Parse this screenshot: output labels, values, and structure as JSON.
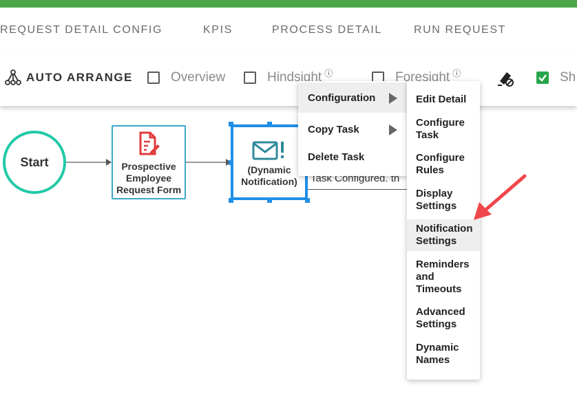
{
  "tabs": [
    "REQUEST DETAIL CONFIG",
    "KPIS",
    "PROCESS DETAIL",
    "RUN REQUEST"
  ],
  "toolbar": {
    "auto_arrange_label": "AUTO ARRANGE",
    "overview_label": "Overview",
    "hindsight_label": "Hindsight",
    "foresight_label": "Foresight",
    "show_label": "Sh",
    "overview_checked": false,
    "hindsight_checked": false,
    "foresight_checked": false,
    "show_checked": true
  },
  "canvas": {
    "start_label": "Start",
    "task1_label_lines": [
      "Prospective",
      "Employee",
      "Request Form"
    ],
    "task2_label_lines": [
      "(Dynamic",
      "Notification)"
    ],
    "tooltip_text": "Task Configured. th"
  },
  "context_menu": {
    "items": [
      "Configuration",
      "Copy Task",
      "Delete Task"
    ]
  },
  "submenu": {
    "items": [
      "Edit Detail",
      "Configure Task",
      "Configure Rules",
      "Display Settings",
      "Notification Settings",
      "Reminders and Timeouts",
      "Advanced Settings",
      "Dynamic Names"
    ]
  },
  "colors": {
    "top_bar": "#4ea64a",
    "start_ring": "#21c9a8",
    "task_border": "#3aa6c9",
    "selected_border": "#1f8fe8",
    "form_icon": "#e23b3b",
    "mail_icon": "#2e8a99",
    "checkbox_checked": "#27a54a",
    "pointer_arrow": "#f0474c"
  },
  "icons": {
    "auto_arrange": "hierarchy-icon",
    "task1": "form-edit-icon",
    "task2": "mail-alert-icon",
    "clear": "eraser-icon",
    "info": "info-icon"
  }
}
